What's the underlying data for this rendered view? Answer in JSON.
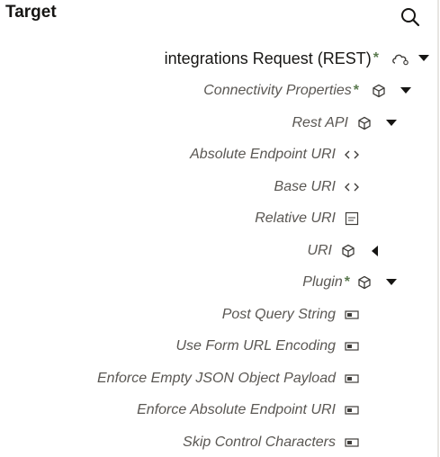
{
  "header": {
    "title": "Target"
  },
  "tree": {
    "root": {
      "label": "integrations Request (REST)",
      "required": "*"
    },
    "connectivity": {
      "label": "Connectivity Properties",
      "required": "*"
    },
    "rest_api": {
      "label": "Rest API"
    },
    "absolute_endpoint_uri": {
      "label": "Absolute Endpoint URI"
    },
    "base_uri": {
      "label": "Base URI"
    },
    "relative_uri": {
      "label": "Relative URI"
    },
    "uri": {
      "label": "URI"
    },
    "plugin": {
      "label": "Plugin",
      "required": "*"
    },
    "post_query_string": {
      "label": "Post Query String"
    },
    "use_form_url_encoding": {
      "label": "Use Form URL Encoding"
    },
    "enforce_empty_json": {
      "label": "Enforce Empty JSON Object Payload"
    },
    "enforce_absolute_endpoint": {
      "label": "Enforce Absolute Endpoint URI"
    },
    "skip_control_characters": {
      "label": "Skip Control Characters"
    }
  }
}
